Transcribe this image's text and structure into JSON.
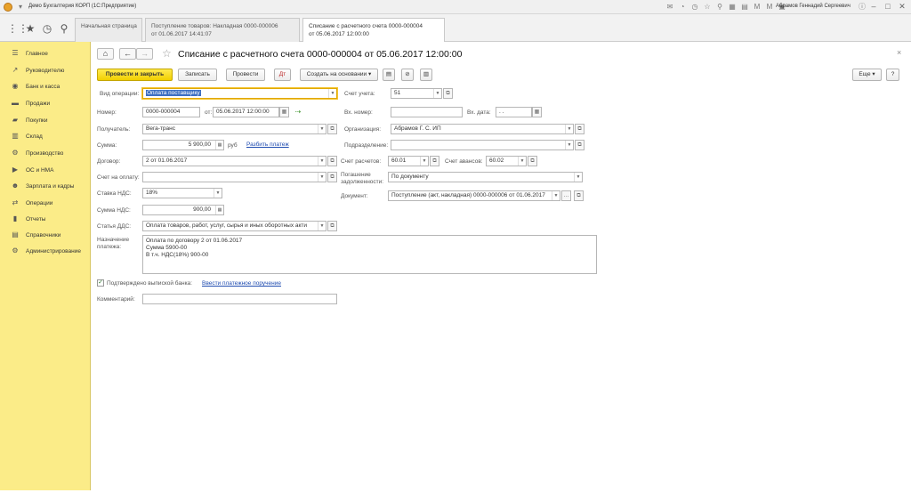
{
  "app_title": "Демо Бухгалтерия КОРП (1С:Предприятие)",
  "user_name": "Абрамов Геннадий Сергеевич",
  "tabs": [
    {
      "label": "Начальная страница"
    },
    {
      "label": "Поступление товаров: Накладная 0000-000006\nот 01.06.2017 14:41:07"
    },
    {
      "label": "Списание с расчетного счета 0000-000004\nот 05.06.2017 12:00:00"
    }
  ],
  "sidebar": {
    "items": [
      {
        "label": "Главное",
        "icon": "list-icon"
      },
      {
        "label": "Руководителю",
        "icon": "trend-icon"
      },
      {
        "label": "Банк и касса",
        "icon": "bank-icon"
      },
      {
        "label": "Продажи",
        "icon": "cart-icon"
      },
      {
        "label": "Покупки",
        "icon": "basket-icon"
      },
      {
        "label": "Склад",
        "icon": "warehouse-icon"
      },
      {
        "label": "Производство",
        "icon": "factory-icon"
      },
      {
        "label": "ОС и НМА",
        "icon": "truck-icon"
      },
      {
        "label": "Зарплата и кадры",
        "icon": "people-icon"
      },
      {
        "label": "Операции",
        "icon": "operations-icon"
      },
      {
        "label": "Отчеты",
        "icon": "chart-icon"
      },
      {
        "label": "Справочники",
        "icon": "book-icon"
      },
      {
        "label": "Администрирование",
        "icon": "gear-icon"
      }
    ]
  },
  "document": {
    "title": "Списание с расчетного счета 0000-000004 от 05.06.2017 12:00:00"
  },
  "toolbar": {
    "post_close": "Провести и закрыть",
    "save": "Записать",
    "post": "Провести",
    "create_based": "Создать на основании",
    "more": "Еще",
    "help": "?"
  },
  "form": {
    "op_type_label": "Вид операции:",
    "op_type_value": "Оплата поставщику",
    "number_label": "Номер:",
    "number_value": "0000-000004",
    "date_label": "от:",
    "date_value": "05.06.2017 12:00:00",
    "recipient_label": "Получатель:",
    "recipient_value": "Вега-транс",
    "sum_label": "Сумма:",
    "sum_value": "5 900,00",
    "currency": "руб",
    "split_link": "Разбить платеж",
    "contract_label": "Договор:",
    "contract_value": "2 от 01.06.2017",
    "invoice_label": "Счет на оплату:",
    "invoice_value": "",
    "vat_rate_label": "Ставка НДС:",
    "vat_rate_value": "18%",
    "vat_sum_label": "Сумма НДС:",
    "vat_sum_value": "900,00",
    "dds_label": "Статья ДДС:",
    "dds_value": "Оплата товаров, работ, услуг, сырья и иных оборотных акти",
    "purpose_label": "Назначение\nплатежа:",
    "purpose_value": "Оплата по договору 2 от 01.06.2017\nСумма 5900-00\nВ т.ч. НДС(18%) 900-00",
    "account_label": "Счет учета:",
    "account_value": "51",
    "in_number_label": "Вх. номер:",
    "in_number_value": "",
    "in_date_label": "Вх. дата:",
    "in_date_value": ". .",
    "org_label": "Организация:",
    "org_value": "Абрамов Г. С. ИП",
    "division_label": "Подразделение:",
    "division_value": "",
    "settle_account_label": "Счет расчетов:",
    "settle_account_value": "60.01",
    "advance_account_label": "Счет авансов:",
    "advance_account_value": "60.02",
    "debt_repay_label": "Погашение\nзадолженности:",
    "debt_repay_value": "По документу",
    "doc_label": "Документ:",
    "doc_value": "Поступление (акт, накладная) 0000-000006 от 01.06.2017",
    "confirmed_label": "Подтверждено выпиской банка:",
    "confirmed": true,
    "enter_order_link": "Ввести платежное поручение",
    "comment_label": "Комментарий:",
    "comment_value": ""
  }
}
